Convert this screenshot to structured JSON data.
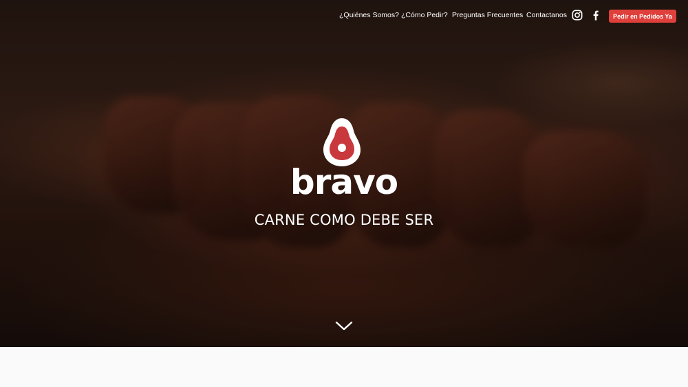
{
  "nav": {
    "links": [
      {
        "label": "¿Quiénes Somos?"
      },
      {
        "label": "¿Cómo Pedir?"
      },
      {
        "label": "Preguntas Frecuentes"
      },
      {
        "label": "Contactanos"
      }
    ],
    "social": [
      {
        "icon": "instagram-icon"
      },
      {
        "icon": "facebook-icon"
      }
    ],
    "cta_label": "Pedir en Pedidos Ya"
  },
  "hero": {
    "brand": "bravo",
    "tagline": "CARNE COMO DEBE SER",
    "logo_icon": "avocado-steak-logo-icon",
    "scroll_icon": "chevron-down-icon"
  },
  "colors": {
    "accent": "#e0403b",
    "logo_red": "#c9383d",
    "text_light": "#ffffff",
    "page_bg": "#fafafa"
  }
}
